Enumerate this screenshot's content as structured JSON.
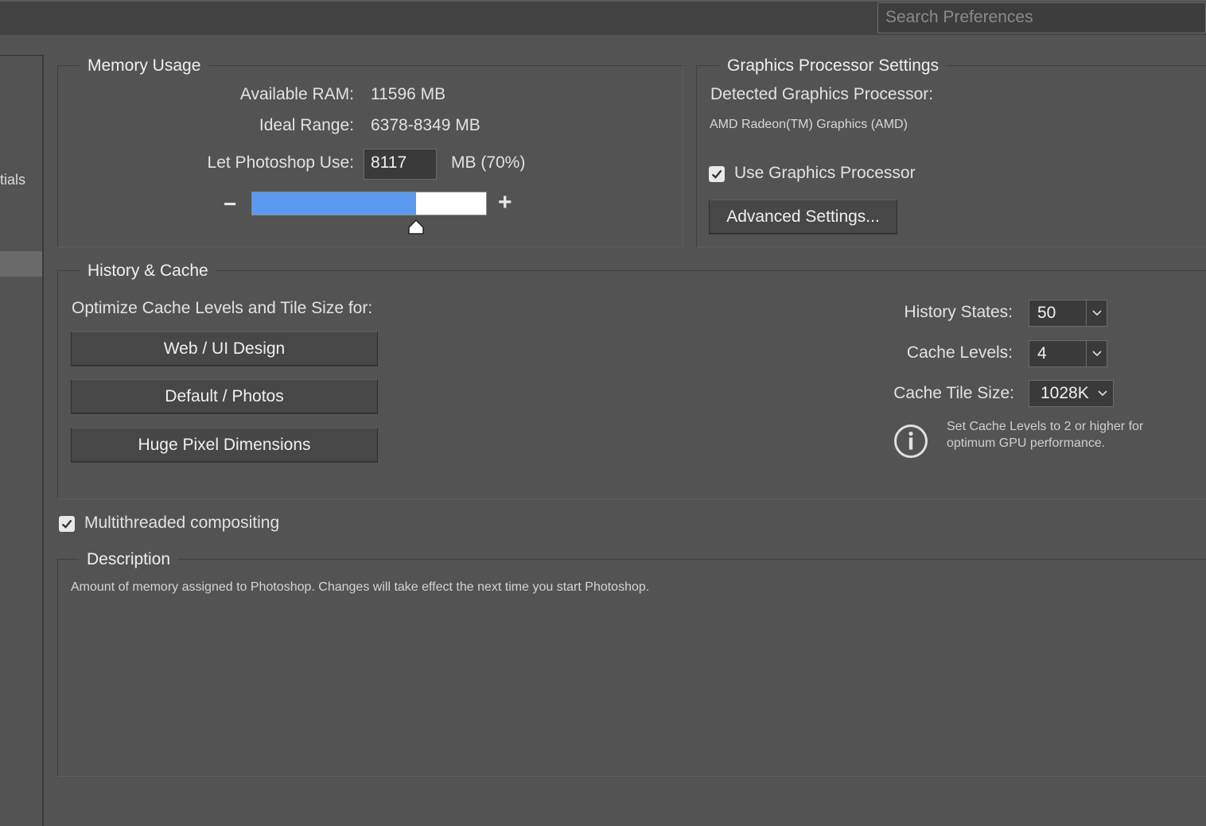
{
  "search": {
    "placeholder": "Search Preferences"
  },
  "sidebar": {
    "partial_label": "tials"
  },
  "memory": {
    "legend": "Memory Usage",
    "available_label": "Available RAM:",
    "available_value": "11596 MB",
    "ideal_label": "Ideal Range:",
    "ideal_value": "6378-8349 MB",
    "use_label": "Let Photoshop Use:",
    "use_value": "8117",
    "use_suffix": "MB (70%)",
    "minus": "−",
    "plus": "+",
    "slider_fraction": 0.7,
    "slider_fill_color": "#5b9af0"
  },
  "gpu": {
    "legend": "Graphics Processor Settings",
    "detected_label": "Detected Graphics Processor:",
    "detected_value": "AMD Radeon(TM) Graphics (AMD)",
    "use_gpu_label": "Use Graphics Processor",
    "use_gpu_checked": true,
    "advanced_button": "Advanced Settings..."
  },
  "history": {
    "legend": "History & Cache",
    "optimize_label": "Optimize Cache Levels and Tile Size for:",
    "buttons": [
      "Web / UI Design",
      "Default / Photos",
      "Huge Pixel Dimensions"
    ],
    "history_states_label": "History States:",
    "history_states_value": "50",
    "cache_levels_label": "Cache Levels:",
    "cache_levels_value": "4",
    "tile_size_label": "Cache Tile Size:",
    "tile_size_value": "1028K",
    "info_line1": "Set Cache Levels to 2 or higher for",
    "info_line2": "optimum GPU performance.",
    "info_icon": "info-icon"
  },
  "multithreaded": {
    "label": "Multithreaded compositing",
    "checked": true
  },
  "description": {
    "legend": "Description",
    "text": "Amount of memory assigned to Photoshop. Changes will take effect the next time you start Photoshop."
  }
}
